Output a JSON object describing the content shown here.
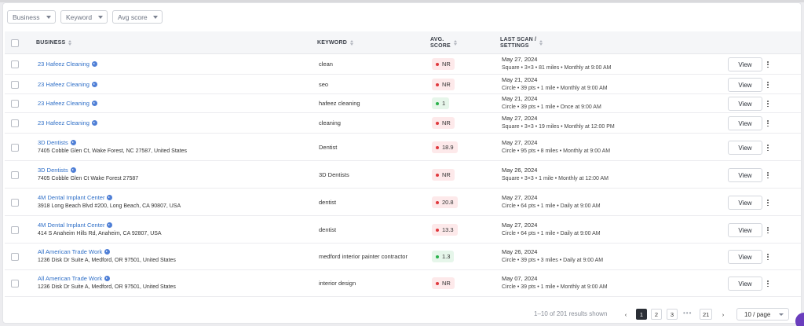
{
  "filters": {
    "business": "Business",
    "keyword": "Keyword",
    "avg_score": "Avg score"
  },
  "columns": {
    "business": "BUSINESS",
    "keyword": "KEYWORD",
    "avg_score_1": "AVG.",
    "avg_score_2": "SCORE",
    "last_scan_1": "LAST SCAN /",
    "last_scan_2": "SETTINGS"
  },
  "rows": [
    {
      "business": "23 Hafeez Cleaning",
      "address": "",
      "keyword": "clean",
      "score": "NR",
      "status": "red",
      "date": "May 27, 2024",
      "settings": "Square • 3×3 • 81 miles • Monthly at 9:00 AM",
      "view": "View"
    },
    {
      "business": "23 Hafeez Cleaning",
      "address": "",
      "keyword": "seo",
      "score": "NR",
      "status": "red",
      "date": "May 21, 2024",
      "settings": "Circle • 39 pts • 1 mile • Monthly at 9:00 AM",
      "view": "View"
    },
    {
      "business": "23 Hafeez Cleaning",
      "address": "",
      "keyword": "hafeez cleaning",
      "score": "1",
      "status": "green",
      "date": "May 21, 2024",
      "settings": "Circle • 39 pts • 1 mile • Once at 9:00 AM",
      "view": "View"
    },
    {
      "business": "23 Hafeez Cleaning",
      "address": "",
      "keyword": "cleaning",
      "score": "NR",
      "status": "red",
      "date": "May 27, 2024",
      "settings": "Square • 3×3 • 19 miles • Monthly at 12:00 PM",
      "view": "View"
    },
    {
      "business": "3D Dentists",
      "address": "7405 Cobble Glen Ct, Wake Forest, NC 27587, United States",
      "keyword": "Dentist",
      "score": "18.9",
      "status": "red",
      "date": "May 27, 2024",
      "settings": "Circle • 95 pts • 8 miles • Monthly at 9:00 AM",
      "view": "View"
    },
    {
      "business": "3D Dentists",
      "address": "7405 Cobble Glen Ct Wake Forest 27587",
      "keyword": "3D Dentists",
      "score": "NR",
      "status": "red",
      "date": "May 26, 2024",
      "settings": "Square • 3×3 • 1 mile • Monthly at 12:00 AM",
      "view": "View"
    },
    {
      "business": "4M Dental Implant Center",
      "address": "3918 Long Beach Blvd #200, Long Beach, CA 90807, USA",
      "keyword": "dentist",
      "score": "20.8",
      "status": "red",
      "date": "May 27, 2024",
      "settings": "Circle • 64 pts • 1 mile • Daily at 9:00 AM",
      "view": "View"
    },
    {
      "business": "4M Dental Implant Center",
      "address": "414 S Anaheim Hills Rd, Anaheim, CA 92807, USA",
      "keyword": "dentist",
      "score": "13.3",
      "status": "red",
      "date": "May 27, 2024",
      "settings": "Circle • 64 pts • 1 mile • Daily at 9:00 AM",
      "view": "View"
    },
    {
      "business": "All American Trade Work",
      "address": "1236 Disk Dr Suite A, Medford, OR 97501, United States",
      "keyword": "medford interior painter contractor",
      "score": "1.3",
      "status": "green",
      "date": "May 26, 2024",
      "settings": "Circle • 39 pts • 3 miles • Daily at 9:00 AM",
      "view": "View"
    },
    {
      "business": "All American Trade Work",
      "address": "1236 Disk Dr Suite A, Medford, OR 97501, United States",
      "keyword": "interior design",
      "score": "NR",
      "status": "red",
      "date": "May 07, 2024",
      "settings": "Circle • 39 pts • 1 mile • Monthly at 9:00 AM",
      "view": "View"
    }
  ],
  "pagination": {
    "summary": "1–10 of 201 results shown",
    "pages": [
      "1",
      "2",
      "3"
    ],
    "ellipsis": "•••",
    "last": "21",
    "active": "1",
    "per_page": "10 / page"
  },
  "colors": {
    "link": "#2f6fc7",
    "red_dot": "#e0393e",
    "green_dot": "#2bb24c"
  }
}
